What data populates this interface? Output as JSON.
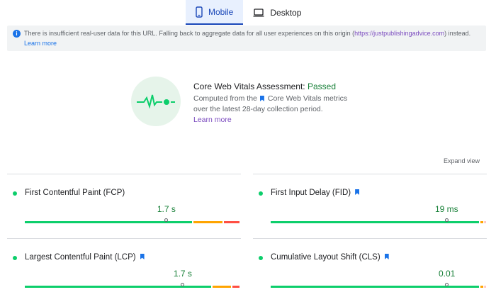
{
  "tabs": [
    {
      "label": "Mobile",
      "icon": "phone-icon",
      "active": true
    },
    {
      "label": "Desktop",
      "icon": "laptop-icon",
      "active": false
    }
  ],
  "banner": {
    "text": "There is insufficient real-user data for this URL. Falling back to aggregate data for all user experiences on this origin (",
    "origin": "https://justpublishingadvice.com",
    "text2": ") instead.",
    "link": "Learn more"
  },
  "assessment": {
    "title": "Core Web Vitals Assessment: ",
    "status": "Passed",
    "desc1": "Computed from the",
    "desc_link": "Core Web Vitals metrics",
    "desc2": "over the latest 28-day collection period.",
    "link": "Learn more"
  },
  "expand_label": "Expand view",
  "colors": {
    "good": "#0cce6b",
    "needs_improvement": "#ffa400",
    "poor": "#ff4e42",
    "accent": "#1a73e8"
  },
  "metrics": [
    {
      "name": "First Contentful Paint (FCP)",
      "value": "1.7 s",
      "bookmark": false,
      "good": 0.78,
      "ni": 0.14,
      "poor": 0.08
    },
    {
      "name": "First Input Delay (FID)",
      "value": "19 ms",
      "bookmark": true,
      "good": 0.97,
      "ni": 0.02,
      "poor": 0.01
    },
    {
      "name": "Largest Contentful Paint (LCP)",
      "value": "1.7 s",
      "bookmark": true,
      "good": 0.87,
      "ni": 0.09,
      "poor": 0.04
    },
    {
      "name": "Cumulative Layout Shift (CLS)",
      "value": "0.01",
      "bookmark": true,
      "good": 0.97,
      "ni": 0.02,
      "poor": 0.01
    }
  ]
}
